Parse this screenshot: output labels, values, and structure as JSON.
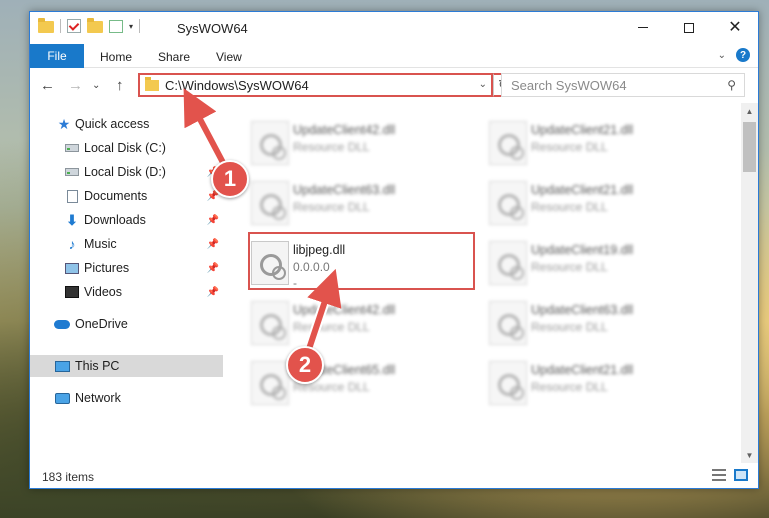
{
  "window": {
    "title": "SysWOW64",
    "controls": {
      "minimize": "",
      "maximize": "",
      "close": "✕"
    }
  },
  "ribbon": {
    "tabs": [
      "File",
      "Home",
      "Share",
      "View"
    ],
    "collapse_glyph": "⌄",
    "help_glyph": "?"
  },
  "nav": {
    "back_glyph": "←",
    "forward_glyph": "→",
    "recent_glyph": "⌄",
    "up_glyph": "↑",
    "address": "C:\\Windows\\SysWOW64",
    "address_chevron": "⌄",
    "refresh_glyph": "↻",
    "search_placeholder": "Search SysWOW64",
    "search_glyph": "⚲"
  },
  "sidebar": {
    "items": [
      {
        "label": "Quick access",
        "icon": "star-icon",
        "pinned": false
      },
      {
        "label": "Local Disk (C:)",
        "icon": "drive-icon",
        "pinned": false
      },
      {
        "label": "Local Disk (D:)",
        "icon": "drive-icon",
        "pinned": true
      },
      {
        "label": "Documents",
        "icon": "documents-icon",
        "pinned": true
      },
      {
        "label": "Downloads",
        "icon": "download-icon",
        "pinned": true
      },
      {
        "label": "Music",
        "icon": "music-icon",
        "pinned": true
      },
      {
        "label": "Pictures",
        "icon": "pictures-icon",
        "pinned": true
      },
      {
        "label": "Videos",
        "icon": "videos-icon",
        "pinned": true
      },
      {
        "label": "OneDrive",
        "icon": "onedrive-icon",
        "pinned": false
      },
      {
        "label": "This PC",
        "icon": "this-pc-icon",
        "pinned": false,
        "selected": true
      },
      {
        "label": "Network",
        "icon": "network-icon",
        "pinned": false
      }
    ],
    "pin_glyph": "📌"
  },
  "files": [
    {
      "name": "UpdateClient42.dll",
      "type": "Resource DLL",
      "blurred": true
    },
    {
      "name": "UpdateClient21.dll",
      "type": "Resource DLL",
      "blurred": true
    },
    {
      "name": "UpdateClient63.dll",
      "type": "Resource DLL",
      "blurred": true
    },
    {
      "name": "UpdateClient21.dll",
      "type": "Resource DLL",
      "blurred": true
    },
    {
      "name": "libjpeg.dll",
      "type": "0.0.0.0",
      "extra": "-",
      "blurred": false
    },
    {
      "name": "UpdateClient19.dll",
      "type": "Resource DLL",
      "blurred": true
    },
    {
      "name": "UpdateClient42.dll",
      "type": "Resource DLL",
      "blurred": true
    },
    {
      "name": "UpdateClient63.dll",
      "type": "Resource DLL",
      "blurred": true
    },
    {
      "name": "UpdateClient65.dll",
      "type": "Resource DLL",
      "blurred": true
    },
    {
      "name": "UpdateClient21.dll",
      "type": "Resource DLL",
      "blurred": true
    }
  ],
  "status": {
    "item_count": "183 items"
  },
  "annotations": {
    "step1": "1",
    "step2": "2",
    "accent": "#e2534c"
  }
}
